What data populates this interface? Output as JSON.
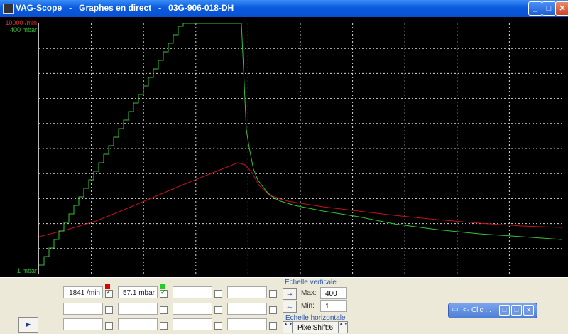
{
  "window": {
    "title": "VAG-Scope   -   Graphes en direct   -   03G-906-018-DH",
    "buttons": {
      "minimize": "_",
      "maximize": "□",
      "close": "✕"
    }
  },
  "graph": {
    "y_labels": {
      "top_red": "10000 /min",
      "top_green": "400 mbar",
      "bottom": "1 mbar"
    },
    "colors": {
      "red": "#c0141e",
      "green": "#36c236",
      "grid": "#d8d8d8",
      "background": "#000000"
    }
  },
  "channels": [
    {
      "value": "1841 /min",
      "checked": true,
      "swatch": "#e00000"
    },
    {
      "value": "57.1 mbar",
      "checked": true,
      "swatch": "#22cc22"
    },
    {
      "value": "",
      "checked": false
    },
    {
      "value": "",
      "checked": false
    },
    {
      "value": "",
      "checked": false
    },
    {
      "value": "",
      "checked": false
    },
    {
      "value": "",
      "checked": false
    },
    {
      "value": "",
      "checked": false
    },
    {
      "value": "",
      "checked": false
    },
    {
      "value": "",
      "checked": false
    },
    {
      "value": "",
      "checked": false
    },
    {
      "value": "",
      "checked": false
    }
  ],
  "vertical_scale": {
    "label": "Echelle verticale",
    "max_label": "Max:",
    "max_value": "400",
    "min_label": "Min:",
    "min_value": "1"
  },
  "horizontal_scale": {
    "label": "Echelle horizontale",
    "value": "PixelShift:6"
  },
  "mini_window": {
    "title": "<- Clic ..."
  },
  "icons": {
    "up_arrow": "→",
    "down_arrow": "←",
    "play": "►",
    "spin": "▲▼"
  }
}
